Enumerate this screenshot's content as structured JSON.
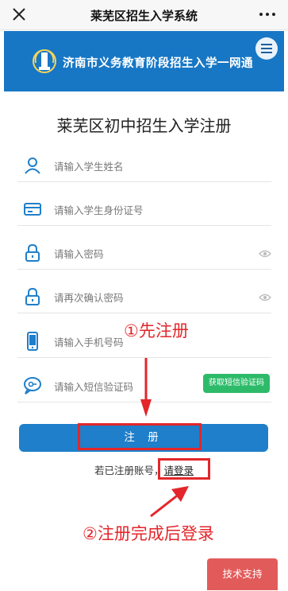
{
  "window": {
    "title": "莱芜区招生入学系统"
  },
  "banner": {
    "site_title": "济南市义务教育阶段招生入学一网通"
  },
  "form": {
    "title": "莱芜区初中招生入学注册",
    "fields": [
      {
        "icon": "user-icon",
        "placeholder": "请输入学生姓名"
      },
      {
        "icon": "id-card-icon",
        "placeholder": "请输入学生身份证号"
      },
      {
        "icon": "lock-icon",
        "placeholder": "请输入密码"
      },
      {
        "icon": "lock-icon",
        "placeholder": "请再次确认密码"
      },
      {
        "icon": "phone-icon",
        "placeholder": "请输入手机号码"
      },
      {
        "icon": "sms-icon",
        "placeholder": "请输入短信验证码"
      }
    ],
    "sms_button": "获取短信验证码",
    "register_button": "注 册",
    "login_prompt": "若已注册账号，",
    "login_link": "请登录"
  },
  "annotations": {
    "step1": "①先注册",
    "step2": "②注册完成后登录"
  },
  "support_button": "技术支持",
  "colors": {
    "banner": "#1777c5",
    "register": "#1f7fca",
    "sms": "#2dbb6a",
    "annotation": "#e3262b",
    "support": "#e25b5b"
  }
}
